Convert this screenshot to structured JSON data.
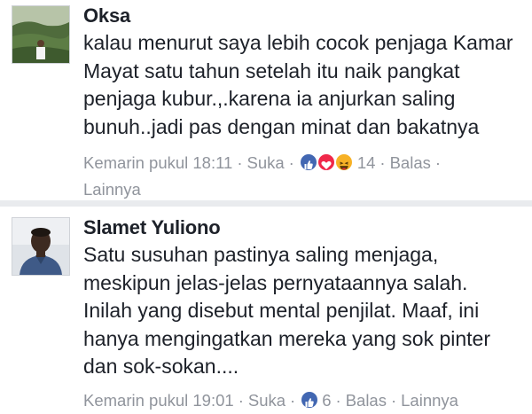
{
  "comments": [
    {
      "author": "Oksa",
      "text": "kalau menurut saya lebih cocok penjaga Kamar\nMayat satu tahun setelah itu naik pangkat\npenjaga kubur.,.karena ia anjurkan saling\nbunuh..jadi pas dengan minat dan bakatnya",
      "timestamp": "Kemarin pukul 18:11",
      "like_label": "Suka",
      "reactions": [
        "like-icon",
        "love-icon",
        "haha-icon"
      ],
      "reaction_count": "14",
      "reply_label": "Balas",
      "more_label": "Lainnya",
      "separator": "·"
    },
    {
      "author": "Slamet Yuliono",
      "text": "Satu susuhan pastinya saling menjaga,\nmeskipun jelas-jelas pernyataannya salah.\nInilah yang disebut mental penjilat. Maaf, ini\nhanya mengingatkan mereka yang sok pinter\ndan sok-sokan....",
      "timestamp": "Kemarin pukul 19:01",
      "like_label": "Suka",
      "reactions": [
        "like-icon"
      ],
      "reaction_count": "6",
      "reply_label": "Balas",
      "more_label": "Lainnya",
      "separator": "·"
    }
  ],
  "colors": {
    "text": "#1d2129",
    "meta": "#90949c",
    "like": "#4267b2",
    "love": "#f0284a",
    "haha": "#f7b125",
    "divider": "#e9ebee"
  }
}
